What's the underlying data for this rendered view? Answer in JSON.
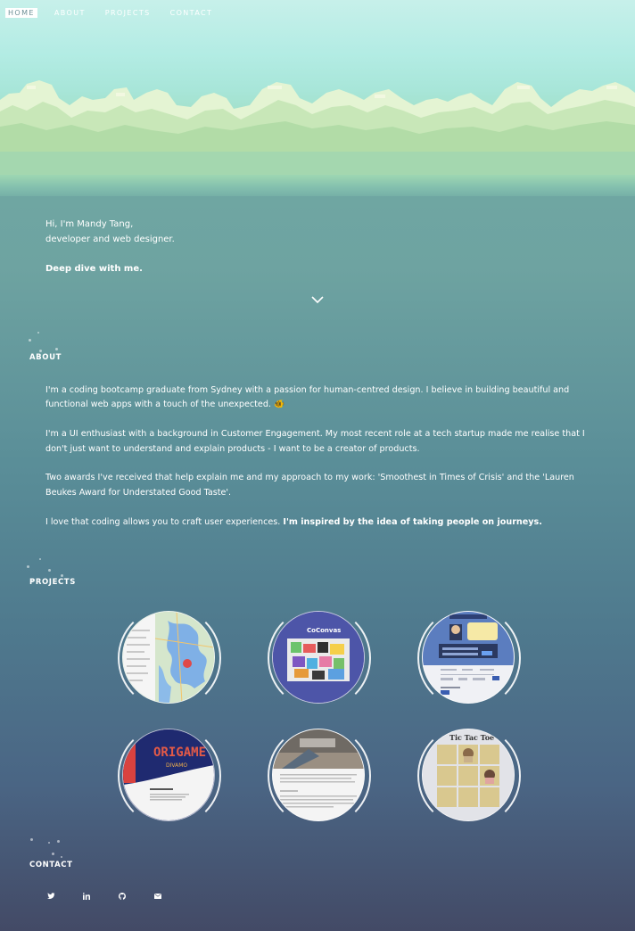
{
  "nav": {
    "items": [
      {
        "label": "HOME",
        "active": true
      },
      {
        "label": "ABOUT",
        "active": false
      },
      {
        "label": "PROJECTS",
        "active": false
      },
      {
        "label": "CONTACT",
        "active": false
      }
    ]
  },
  "hero": {
    "line1": "Hi, I'm Mandy Tang,",
    "line2": "developer and web designer.",
    "cta": "Deep dive with me.",
    "scroll_icon": "chevron-down-icon"
  },
  "about": {
    "title": "ABOUT",
    "p1": "I'm a coding bootcamp graduate from Sydney with a passion for human-centred design. I believe in building beautiful and functional web apps with a touch of the unexpected.",
    "p1_emoji": "🐠",
    "p2": "I'm a UI enthusiast with a background in Customer Engagement. My most recent role at a tech startup made me realise that I don't just want to understand and explain products - I want to be a creator of products.",
    "p3": "Two awards I've received that help explain me and my approach to my work: 'Smoothest in Times of Crisis' and the 'Lauren Beukes Award for Understated Good Taste'.",
    "p4_plain": "I love that coding allows you to craft user experiences.",
    "p4_bold": "I'm inspired by the idea of taking people on journeys."
  },
  "projects": {
    "title": "PROJECTS",
    "items": [
      {
        "name": "map-project"
      },
      {
        "name": "coconvas-project",
        "heading": "CoConvas"
      },
      {
        "name": "game-login-project"
      },
      {
        "name": "origami-project",
        "heading": "ORIGAME"
      },
      {
        "name": "blog-project"
      },
      {
        "name": "tictactoe-project",
        "heading": "Tic Tac Toe"
      }
    ]
  },
  "contact": {
    "title": "CONTACT",
    "icons": [
      "twitter-icon",
      "linkedin-icon",
      "github-icon",
      "email-icon"
    ]
  }
}
